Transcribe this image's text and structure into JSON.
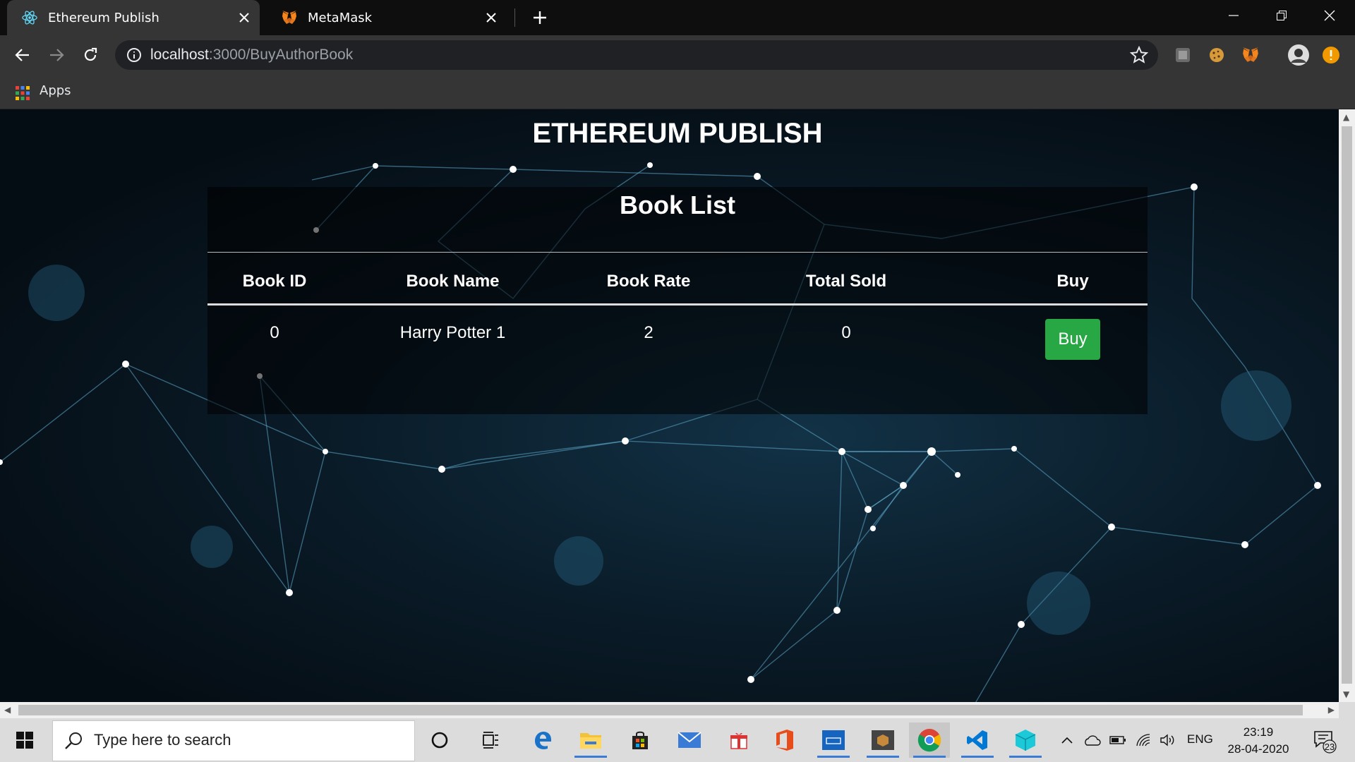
{
  "browser": {
    "tabs": [
      {
        "title": "Ethereum Publish",
        "active": true,
        "icon": "react-icon"
      },
      {
        "title": "MetaMask",
        "active": false,
        "icon": "metamask-fox-icon"
      }
    ],
    "url_host": "localhost",
    "url_path": ":3000/BuyAuthorBook",
    "bookmarks": {
      "apps_label": "Apps"
    }
  },
  "page": {
    "title": "ETHEREUM PUBLISH",
    "panel_title": "Book List",
    "table": {
      "headers": [
        "Book ID",
        "Book Name",
        "Book Rate",
        "Total Sold",
        "Buy"
      ],
      "rows": [
        {
          "book_id": "0",
          "book_name": "Harry Potter 1",
          "book_rate": "2",
          "total_sold": "0",
          "action": "Buy"
        }
      ]
    }
  },
  "taskbar": {
    "search_placeholder": "Type here to search",
    "language": "ENG",
    "time": "23:19",
    "date": "28-04-2020",
    "notifications": "23"
  },
  "colors": {
    "buy_button": "#28a745",
    "page_background": "#0a1c29",
    "network_lines": "#6fb6d6"
  }
}
